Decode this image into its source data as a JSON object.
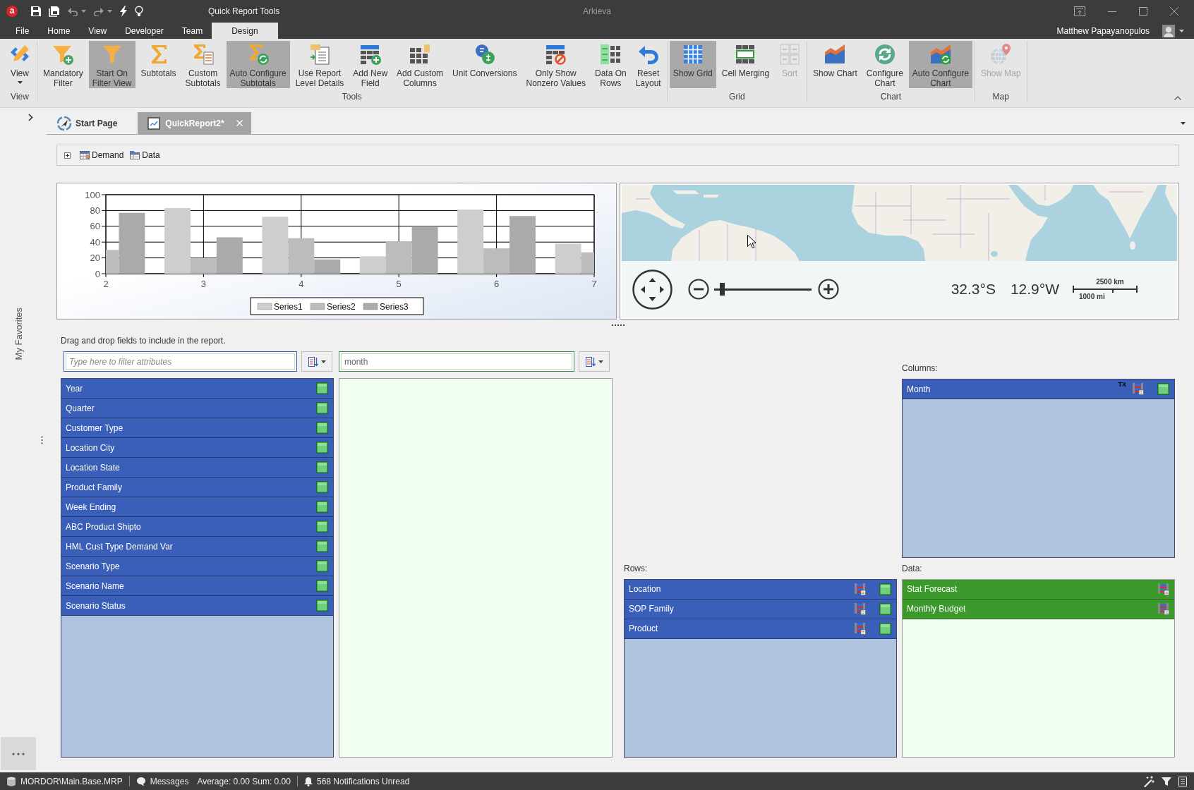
{
  "title_bar": {
    "logo": "a",
    "title": "Quick Report Tools",
    "app_name": "Arkieva"
  },
  "menu": {
    "tabs": [
      {
        "label": "File",
        "selected": false
      },
      {
        "label": "Home",
        "selected": false
      },
      {
        "label": "View",
        "selected": false
      },
      {
        "label": "Developer",
        "selected": false
      },
      {
        "label": "Team",
        "selected": false
      },
      {
        "label": "Design",
        "selected": true
      }
    ],
    "user": "Matthew Papayanopulos"
  },
  "ribbon": {
    "groups": [
      {
        "label": "View",
        "buttons": [
          {
            "label": "View",
            "kind": "dropdown",
            "pressed": false,
            "disabled": false
          }
        ]
      },
      {
        "label": "Tools",
        "buttons": [
          {
            "label": "Mandatory\nFilter",
            "kind": "large",
            "pressed": false,
            "disabled": false
          },
          {
            "label": "Start On\nFilter View",
            "kind": "large",
            "pressed": true,
            "disabled": false
          },
          {
            "label": "Subtotals",
            "kind": "large",
            "pressed": false,
            "disabled": false
          },
          {
            "label": "Custom\nSubtotals",
            "kind": "large",
            "pressed": false,
            "disabled": false
          },
          {
            "label": "Auto Configure\nSubtotals",
            "kind": "large",
            "pressed": true,
            "disabled": false
          },
          {
            "label": "Use Report\nLevel Details",
            "kind": "large",
            "pressed": false,
            "disabled": false
          },
          {
            "label": "Add New\nField",
            "kind": "large",
            "pressed": false,
            "disabled": false
          },
          {
            "label": "Add Custom\nColumns",
            "kind": "large",
            "pressed": false,
            "disabled": false
          },
          {
            "label": "Unit Conversions",
            "kind": "large",
            "pressed": false,
            "disabled": false
          },
          {
            "label": "Only Show\nNonzero Values",
            "kind": "large",
            "pressed": false,
            "disabled": false
          },
          {
            "label": "Data On\nRows",
            "kind": "large",
            "pressed": false,
            "disabled": false
          },
          {
            "label": "Reset\nLayout",
            "kind": "large",
            "pressed": false,
            "disabled": false
          }
        ]
      },
      {
        "label": "Grid",
        "buttons": [
          {
            "label": "Show Grid",
            "kind": "large",
            "pressed": true,
            "disabled": false
          },
          {
            "label": "Cell Merging",
            "kind": "large",
            "pressed": false,
            "disabled": false
          },
          {
            "label": "Sort",
            "kind": "large",
            "pressed": false,
            "disabled": true
          }
        ]
      },
      {
        "label": "Chart",
        "buttons": [
          {
            "label": "Show Chart",
            "kind": "large",
            "pressed": false,
            "disabled": false
          },
          {
            "label": "Configure\nChart",
            "kind": "large",
            "pressed": false,
            "disabled": false
          },
          {
            "label": "Auto Configure\nChart",
            "kind": "large",
            "pressed": true,
            "disabled": false
          }
        ]
      },
      {
        "label": "Map",
        "buttons": [
          {
            "label": "Show Map",
            "kind": "large",
            "pressed": false,
            "disabled": true
          }
        ]
      }
    ]
  },
  "sidebar": {
    "favorites": "My Favorites"
  },
  "document_tabs": [
    {
      "label": "Start Page",
      "selected": false,
      "closable": false
    },
    {
      "label": "QuickReport2*",
      "selected": true,
      "closable": true
    }
  ],
  "breadcrumb": [
    "Demand",
    "Data"
  ],
  "chart": {
    "chart_data": {
      "type": "bar",
      "x": [
        2,
        3,
        4,
        5,
        6,
        7
      ],
      "series": [
        {
          "name": "Series1",
          "color": "#cecece",
          "values": [
            null,
            83,
            72,
            22,
            81,
            38
          ]
        },
        {
          "name": "Series2",
          "color": "#bcbcbc",
          "values": [
            30,
            20,
            45,
            41,
            32,
            27
          ]
        },
        {
          "name": "Series3",
          "color": "#aaaaaa",
          "values": [
            77,
            46,
            18,
            60,
            73,
            null
          ]
        }
      ],
      "xlim": [
        2,
        7
      ],
      "ylim": [
        0,
        100
      ],
      "xticks": [
        2,
        3,
        4,
        5,
        6,
        7
      ],
      "yticks": [
        0,
        20,
        40,
        60,
        80,
        100
      ],
      "grid": true,
      "legend": true
    }
  },
  "map": {
    "latitude": "32.3°S",
    "longitude": "12.9°W",
    "scale": {
      "top": "2500 km",
      "bottom": "1000 mi"
    },
    "zoom": {
      "level": 0.08
    }
  },
  "field_chooser": {
    "hint": "Drag and drop fields to include in the report.",
    "attribute_filter": {
      "placeholder": "Type here to filter attributes"
    },
    "measure_filter": {
      "value": "month"
    },
    "attributes": [
      "Year",
      "Quarter",
      "Customer Type",
      "Location City",
      "Location State",
      "Product Family",
      "Week Ending",
      "ABC Product Shipto",
      "HML Cust Type Demand Var",
      "Scenario Type",
      "Scenario Name",
      "Scenario Status"
    ]
  },
  "pivot": {
    "columns": {
      "label": "Columns:",
      "kind": "attribute",
      "items": [
        {
          "label": "Month",
          "tag": "TX"
        }
      ]
    },
    "rows": {
      "label": "Rows:",
      "kind": "attribute",
      "items": [
        {
          "label": "Location"
        },
        {
          "label": "SOP Family"
        },
        {
          "label": "Product"
        }
      ]
    },
    "data": {
      "label": "Data:",
      "kind": "measure",
      "items": [
        {
          "label": "Stat Forecast"
        },
        {
          "label": "Monthly Budget"
        }
      ]
    }
  },
  "status_bar": {
    "database": "MORDOR\\Main.Base.MRP",
    "messages": "Messages",
    "summary": "Average: 0.00 Sum: 0.00",
    "notifications": "568 Notifications Unread"
  }
}
